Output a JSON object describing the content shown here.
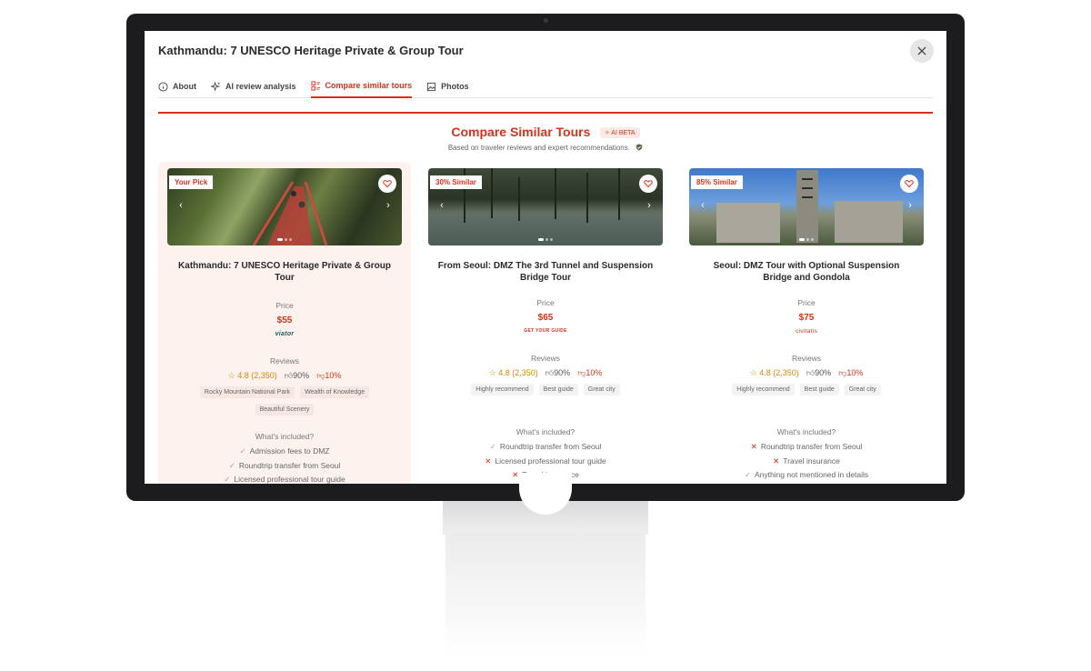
{
  "modal": {
    "title": "Kathmandu: 7 UNESCO Heritage Private & Group Tour"
  },
  "tabs": [
    {
      "label": "About",
      "icon": "info-icon"
    },
    {
      "label": "AI review analysis",
      "icon": "sparkle-icon"
    },
    {
      "label": "Compare similar tours",
      "icon": "compare-icon",
      "active": true
    },
    {
      "label": "Photos",
      "icon": "photos-icon"
    }
  ],
  "section": {
    "title": "Compare Similar Tours",
    "badge": "AI BETA",
    "subtitle": "Based on traveler reviews and expert recommendations."
  },
  "cards": [
    {
      "tag": "Your Pick",
      "title": "Kathmandu: 7 UNESCO Heritage Private & Group Tour",
      "price_label": "Price",
      "price": "$55",
      "vendor": "viator",
      "reviews_label": "Reviews",
      "rating": "4.8 (2,350)",
      "up": "90%",
      "down": "10%",
      "chips": [
        "Rocky Mountain National Park",
        "Wealth of Knowledge",
        "Beautiful Scenery"
      ],
      "included_label": "What's included?",
      "included": [
        {
          "text": "Admission fees to DMZ",
          "ok": true
        },
        {
          "text": "Roundtrip transfer from Seoul",
          "ok": true
        },
        {
          "text": "Licensed professional tour guide",
          "ok": true
        }
      ]
    },
    {
      "tag": "30% Similar",
      "title": "From Seoul: DMZ The 3rd Tunnel and Suspension Bridge Tour",
      "price_label": "Price",
      "price": "$65",
      "vendor": "GET YOUR GUIDE",
      "reviews_label": "Reviews",
      "rating": "4.8 (2,350)",
      "up": "90%",
      "down": "10%",
      "chips": [
        "Highly recommend",
        "Best guide",
        "Great city"
      ],
      "included_label": "What's included?",
      "included": [
        {
          "text": "Roundtrip transfer from Seoul",
          "ok": true
        },
        {
          "text": "Licensed professional tour guide",
          "ok": false
        },
        {
          "text": "Travel insurance",
          "ok": false
        }
      ]
    },
    {
      "tag": "85% Similar",
      "title": "Seoul: DMZ Tour with Optional Suspension Bridge and Gondola",
      "price_label": "Price",
      "price": "$75",
      "vendor": "civitatis",
      "reviews_label": "Reviews",
      "rating": "4.8 (2,350)",
      "up": "90%",
      "down": "10%",
      "chips": [
        "Highly recommend",
        "Best guide",
        "Great city"
      ],
      "included_label": "What's included?",
      "included": [
        {
          "text": "Roundtrip transfer from Seoul",
          "ok": false
        },
        {
          "text": "Travel insurance",
          "ok": false
        },
        {
          "text": "Anything not mentioned in details",
          "ok": true
        }
      ]
    }
  ],
  "colors": {
    "accent": "#d4331b",
    "rating": "#d28b00",
    "pick_bg": "#fdf2ee"
  }
}
